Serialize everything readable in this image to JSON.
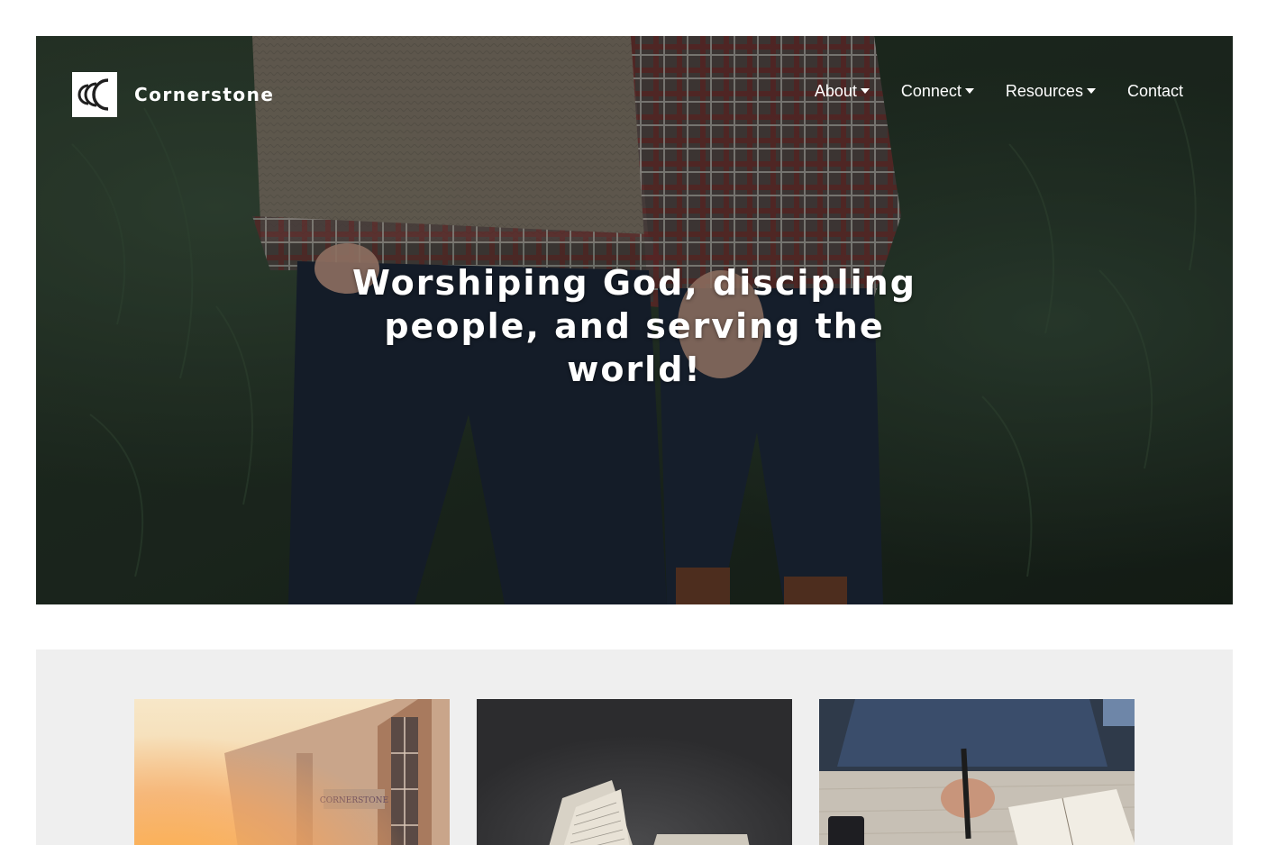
{
  "brand": {
    "name": "Cornerstone",
    "logo_icon": "cornerstone-ccc-logo"
  },
  "nav": {
    "items": [
      {
        "label": "About",
        "has_dropdown": true
      },
      {
        "label": "Connect",
        "has_dropdown": true
      },
      {
        "label": "Resources",
        "has_dropdown": true
      },
      {
        "label": "Contact",
        "has_dropdown": false
      }
    ]
  },
  "hero": {
    "headline": "Worshiping God, discipling people, and serving the world!",
    "image": "couple-holding-hands-photo"
  },
  "cards": [
    {
      "image": "church-building-photo"
    },
    {
      "image": "open-bible-photo"
    },
    {
      "image": "bible-study-notes-photo"
    }
  ],
  "colors": {
    "section_background": "#efefef",
    "nav_text": "#ffffff"
  }
}
